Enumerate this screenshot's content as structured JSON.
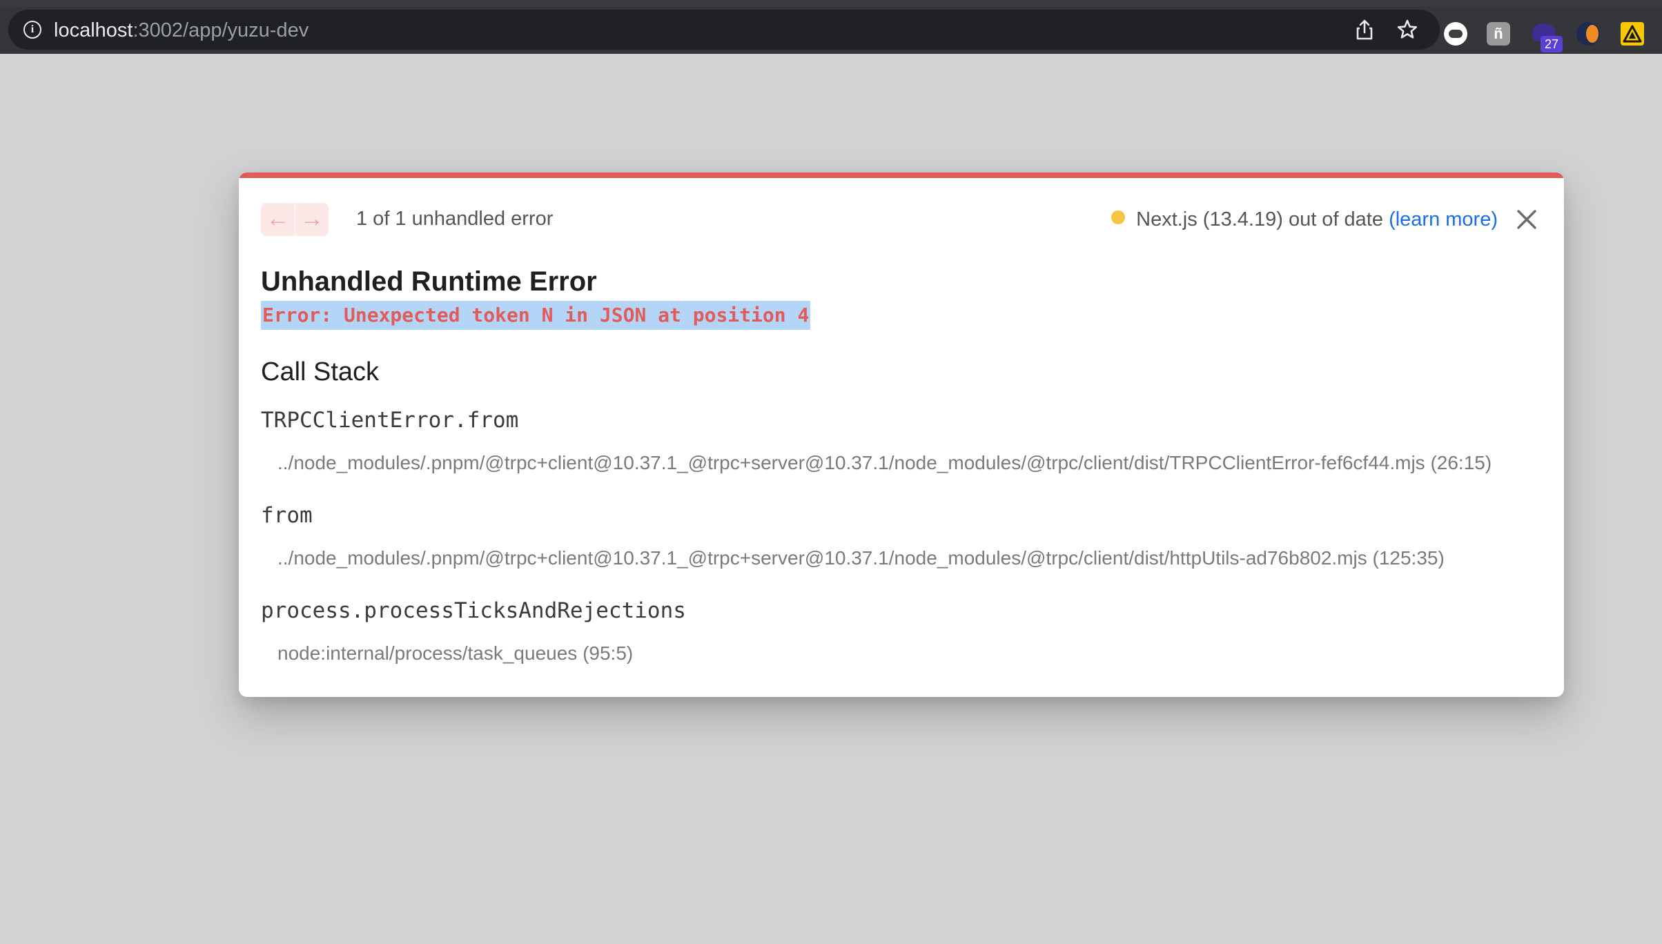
{
  "browser": {
    "url_host": "localhost",
    "url_path": ":3002/app/yuzu-dev",
    "info_icon": "i",
    "extensions": [
      {
        "icon": "chat-bubble-extension-icon"
      },
      {
        "icon": "letter-extension-icon",
        "glyph": "ñ"
      },
      {
        "icon": "wizard-hat-extension-icon",
        "badge": "27"
      },
      {
        "icon": "moon-extension-icon"
      },
      {
        "icon": "triangle-extension-icon"
      }
    ]
  },
  "dialog": {
    "accent_color": "#e25b5b",
    "nav": {
      "prev": "←",
      "next": "→"
    },
    "count_text": "1 of 1 unhandled error",
    "version_text": "Next.js (13.4.19) out of date",
    "version_link": "(learn more)",
    "title": "Unhandled Runtime Error",
    "message": "Error: Unexpected token N in JSON at position 4",
    "callstack_title": "Call Stack",
    "frames": [
      {
        "fn": "TRPCClientError.from",
        "loc": "../node_modules/.pnpm/@trpc+client@10.37.1_@trpc+server@10.37.1/node_modules/@trpc/client/dist/TRPCClientError-fef6cf44.mjs (26:15)"
      },
      {
        "fn": "from",
        "loc": "../node_modules/.pnpm/@trpc+client@10.37.1_@trpc+server@10.37.1/node_modules/@trpc/client/dist/httpUtils-ad76b802.mjs (125:35)"
      },
      {
        "fn": "process.processTicksAndRejections",
        "loc": "node:internal/process/task_queues (95:5)"
      }
    ]
  }
}
